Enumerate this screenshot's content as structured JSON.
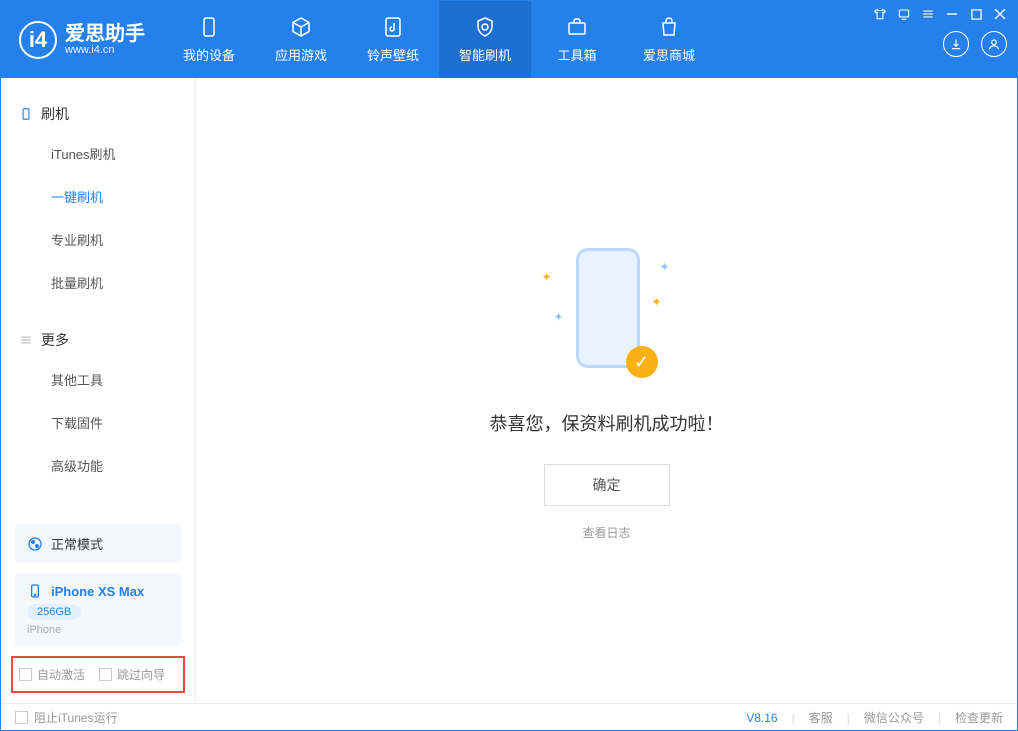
{
  "app": {
    "name": "爱思助手",
    "url": "www.i4.cn"
  },
  "nav": {
    "items": [
      {
        "label": "我的设备"
      },
      {
        "label": "应用游戏"
      },
      {
        "label": "铃声壁纸"
      },
      {
        "label": "智能刷机"
      },
      {
        "label": "工具箱"
      },
      {
        "label": "爱思商城"
      }
    ]
  },
  "sidebar": {
    "section1": {
      "title": "刷机",
      "items": [
        "iTunes刷机",
        "一键刷机",
        "专业刷机",
        "批量刷机"
      ]
    },
    "section2": {
      "title": "更多",
      "items": [
        "其他工具",
        "下载固件",
        "高级功能"
      ]
    },
    "mode": "正常模式",
    "device": {
      "name": "iPhone XS Max",
      "capacity": "256GB",
      "type": "iPhone"
    },
    "checks": {
      "auto_activate": "自动激活",
      "skip_guide": "跳过向导"
    }
  },
  "main": {
    "success_text": "恭喜您，保资料刷机成功啦！",
    "ok_button": "确定",
    "log_link": "查看日志"
  },
  "footer": {
    "block_itunes": "阻止iTunes运行",
    "version": "V8.16",
    "links": [
      "客服",
      "微信公众号",
      "检查更新"
    ]
  }
}
